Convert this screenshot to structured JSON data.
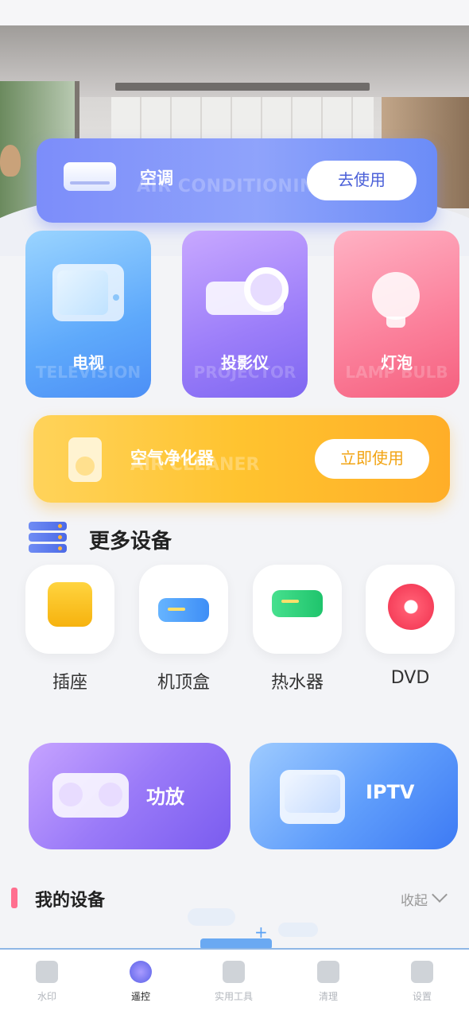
{
  "hero": {
    "ac": {
      "title": "空调",
      "en": "AIR CONDITIONING",
      "button": "去使用"
    }
  },
  "devices": [
    {
      "title": "电视",
      "en": "TELEVISION",
      "icon": "tv-icon"
    },
    {
      "title": "投影仪",
      "en": "PROJECTOR",
      "icon": "projector-icon"
    },
    {
      "title": "灯泡",
      "en": "LAMP BULB",
      "icon": "bulb-icon"
    }
  ],
  "cleaner": {
    "title": "空气净化器",
    "en": "AIR CLEANER",
    "button": "立即使用"
  },
  "more": {
    "title": "更多设备",
    "items": [
      {
        "label": "插座",
        "icon": "socket-icon"
      },
      {
        "label": "机顶盒",
        "icon": "set-top-box-icon"
      },
      {
        "label": "热水器",
        "icon": "water-heater-icon"
      },
      {
        "label": "DVD",
        "icon": "dvd-icon"
      }
    ]
  },
  "big": [
    {
      "label": "功放",
      "icon": "amplifier-icon"
    },
    {
      "label": "IPTV",
      "icon": "iptv-icon"
    }
  ],
  "mydevices": {
    "title": "我的设备",
    "collapse": "收起"
  },
  "tabs": [
    {
      "label": "水印",
      "icon": "stamp-icon"
    },
    {
      "label": "遥控",
      "icon": "remote-icon",
      "active": true
    },
    {
      "label": "实用工具",
      "icon": "toolbox-icon"
    },
    {
      "label": "清理",
      "icon": "broom-icon"
    },
    {
      "label": "设置",
      "icon": "gear-icon"
    }
  ]
}
